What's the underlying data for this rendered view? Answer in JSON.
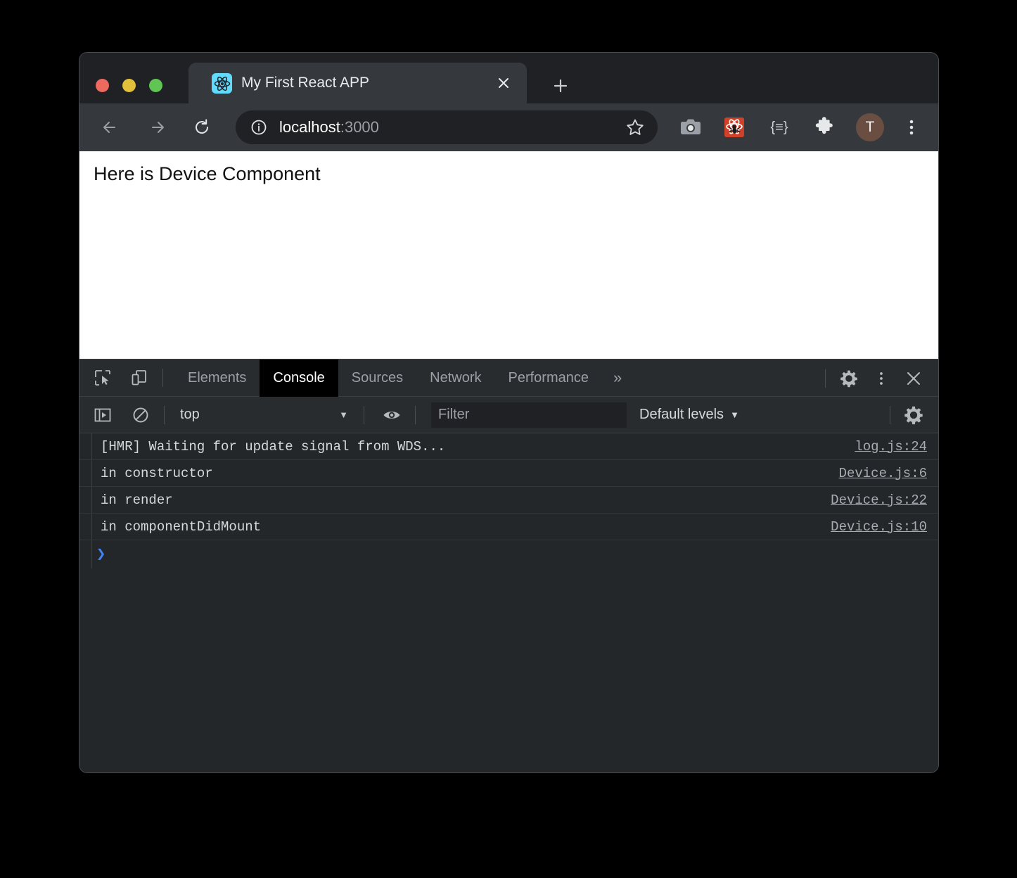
{
  "window": {
    "traffic_lights": [
      {
        "name": "close",
        "color": "#ed6a5e"
      },
      {
        "name": "minimize",
        "color": "#e3c03a"
      },
      {
        "name": "maximize",
        "color": "#61c554"
      }
    ]
  },
  "tabstrip": {
    "active_tab": {
      "title": "My First React APP",
      "favicon": "react-logo-icon",
      "close_label": "✕"
    },
    "new_tab_label": "+"
  },
  "toolbar": {
    "back_icon": "back-arrow-icon",
    "forward_icon": "forward-arrow-icon",
    "reload_icon": "reload-icon",
    "site_info_icon": "info-circle-icon",
    "url_host": "localhost",
    "url_port": ":3000",
    "url_full": "localhost:3000",
    "bookmark_icon": "star-icon",
    "extensions": [
      {
        "name": "camera-extension-icon",
        "label": "camera"
      },
      {
        "name": "react-devtools-extension-icon",
        "label": "React Developer Tools",
        "color": "#d0412a"
      },
      {
        "name": "json-viewer-extension-icon",
        "label": "{≡}"
      },
      {
        "name": "extensions-puzzle-icon",
        "label": "Extensions"
      }
    ],
    "avatar_initial": "T",
    "avatar_color": "#6b4e42",
    "menu_icon": "three-dot-menu-icon"
  },
  "page": {
    "heading": "Here is Device Component"
  },
  "devtools": {
    "inspect_icon": "inspect-element-icon",
    "device_toggle_icon": "device-toolbar-icon",
    "tabs": [
      {
        "label": "Elements",
        "active": false
      },
      {
        "label": "Console",
        "active": true
      },
      {
        "label": "Sources",
        "active": false
      },
      {
        "label": "Network",
        "active": false
      },
      {
        "label": "Performance",
        "active": false
      }
    ],
    "more_tabs_label": "»",
    "settings_icon": "gear-icon",
    "more_options_icon": "three-dot-vertical-icon",
    "close_icon": "close-x-icon",
    "console_toolbar": {
      "sidebar_toggle_icon": "console-sidebar-toggle-icon",
      "clear_icon": "clear-console-icon",
      "context_value": "top",
      "eye_icon": "live-expression-eye-icon",
      "filter_placeholder": "Filter",
      "filter_value": "",
      "levels_value": "Default levels",
      "settings_icon": "gear-icon"
    },
    "console_messages": [
      {
        "text": "[HMR] Waiting for update signal from WDS...",
        "source": "log.js:24"
      },
      {
        "text": "in constructor",
        "source": "Device.js:6"
      },
      {
        "text": "in render",
        "source": "Device.js:22"
      },
      {
        "text": "in componentDidMount",
        "source": "Device.js:10"
      }
    ],
    "prompt_caret": "❯",
    "prompt_value": ""
  }
}
